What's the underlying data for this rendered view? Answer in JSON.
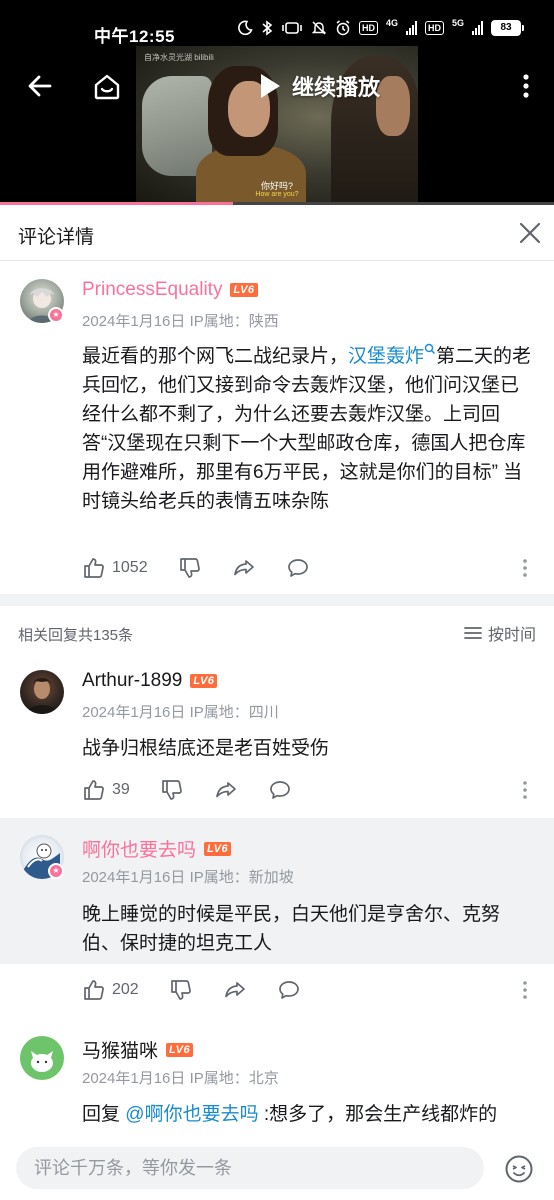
{
  "status_bar": {
    "time": "中午12:55",
    "battery": "83",
    "net1": "4G",
    "net2": "5G",
    "hd": "HD"
  },
  "video": {
    "resume_label": "继续播放",
    "watermark": "自净水灵光湖 bilibili",
    "subtitle_cn": "你好吗?",
    "subtitle_en": "How are you?",
    "progress": 0.42
  },
  "panel": {
    "title": "评论详情"
  },
  "main_comment": {
    "username": "PrincessEquality",
    "level": "LV6",
    "date": "2024年1月16日",
    "ip": "IP属地：陕西",
    "content_before": "最近看的那个网飞二战纪录片，",
    "content_link": "汉堡轰炸",
    "content_after": "第二天的老兵回忆，他们又接到命令去轰炸汉堡，他们问汉堡已经什么都不剩了，为什么还要去轰炸汉堡。上司回答“汉堡现在只剩下一个大型邮政仓库，德国人把仓库用作避难所，那里有6万平民，这就是你们的目标” 当时镜头给老兵的表情五味杂陈",
    "likes": "1052"
  },
  "replies_header": {
    "count_label": "相关回复共135条",
    "sort_label": "按时间"
  },
  "replies": [
    {
      "username": "Arthur-1899",
      "level": "LV6",
      "date": "2024年1月16日",
      "ip": "IP属地：四川",
      "content": "战争归根结底还是老百姓受伤",
      "likes": "39"
    },
    {
      "username": "啊你也要去吗",
      "level": "LV6",
      "date": "2024年1月16日",
      "ip": "IP属地：新加坡",
      "content": "晚上睡觉的时候是平民，白天他们是亨舍尔、克努伯、保时捷的坦克工人",
      "likes": "202"
    },
    {
      "username": "马猴猫咪",
      "level": "LV6",
      "date": "2024年1月16日",
      "ip": "IP属地：北京",
      "reply_prefix": "回复 ",
      "mention": "@啊你也要去吗",
      "content": " :想多了，那会生产线都炸的"
    }
  ],
  "input": {
    "placeholder": "评论千万条，等你发一条"
  },
  "colors": {
    "pink": "#fb7299",
    "link": "#178bcf",
    "level": "#ff6d3d",
    "text_gray": "#9499a0"
  }
}
